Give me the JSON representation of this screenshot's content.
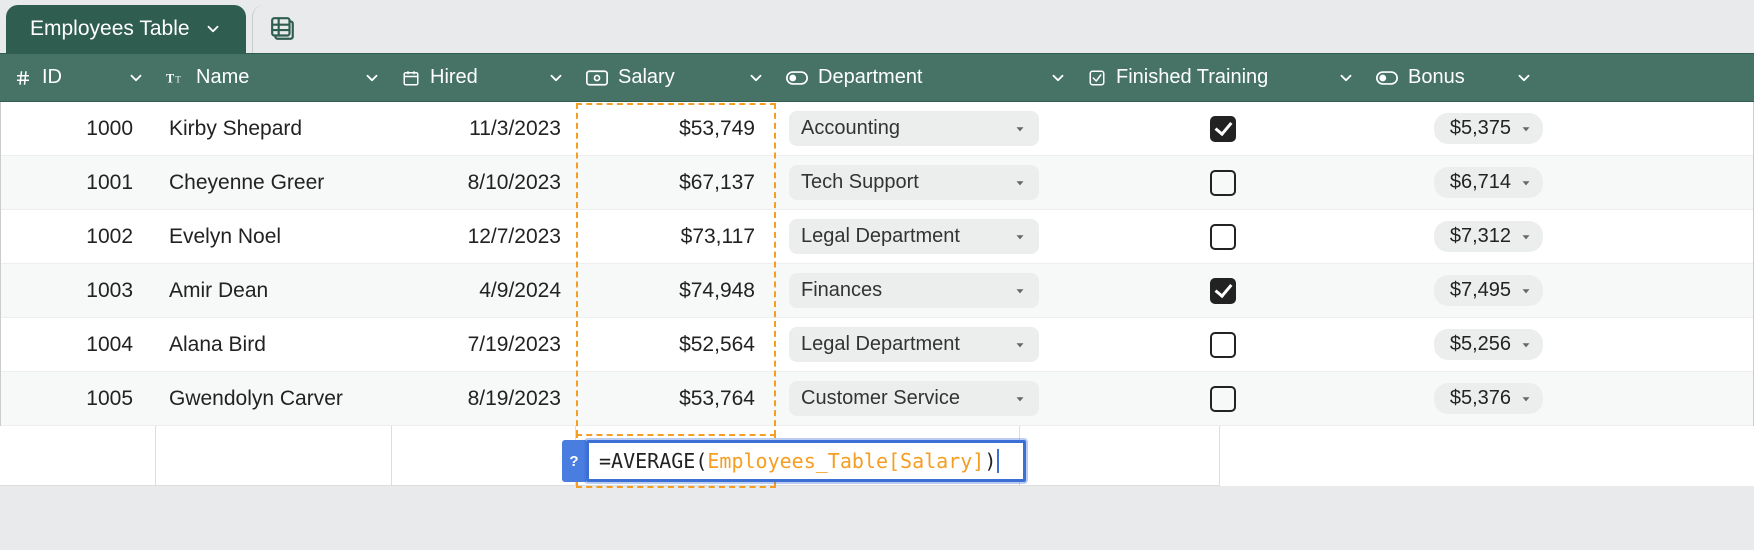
{
  "tab": {
    "title": "Employees Table"
  },
  "columns": {
    "id": {
      "label": "ID"
    },
    "name": {
      "label": "Name"
    },
    "hired": {
      "label": "Hired"
    },
    "salary": {
      "label": "Salary"
    },
    "dept": {
      "label": "Department"
    },
    "train": {
      "label": "Finished Training"
    },
    "bonus": {
      "label": "Bonus"
    }
  },
  "rows": [
    {
      "id": "1000",
      "name": "Kirby Shepard",
      "hired": "11/3/2023",
      "salary": "$53,749",
      "dept": "Accounting",
      "trained": true,
      "bonus": "$5,375"
    },
    {
      "id": "1001",
      "name": "Cheyenne Greer",
      "hired": "8/10/2023",
      "salary": "$67,137",
      "dept": "Tech Support",
      "trained": false,
      "bonus": "$6,714"
    },
    {
      "id": "1002",
      "name": "Evelyn Noel",
      "hired": "12/7/2023",
      "salary": "$73,117",
      "dept": "Legal Department",
      "trained": false,
      "bonus": "$7,312"
    },
    {
      "id": "1003",
      "name": "Amir Dean",
      "hired": "4/9/2024",
      "salary": "$74,948",
      "dept": "Finances",
      "trained": true,
      "bonus": "$7,495"
    },
    {
      "id": "1004",
      "name": "Alana Bird",
      "hired": "7/19/2023",
      "salary": "$52,564",
      "dept": "Legal Department",
      "trained": false,
      "bonus": "$5,256"
    },
    {
      "id": "1005",
      "name": "Gwendolyn Carver",
      "hired": "8/19/2023",
      "salary": "$53,764",
      "dept": "Customer Service",
      "trained": false,
      "bonus": "$5,376"
    }
  ],
  "formula": {
    "prefix": "=AVERAGE(",
    "ref": "Employees_Table[Salary]",
    "suffix": ")",
    "help_label": "?"
  }
}
